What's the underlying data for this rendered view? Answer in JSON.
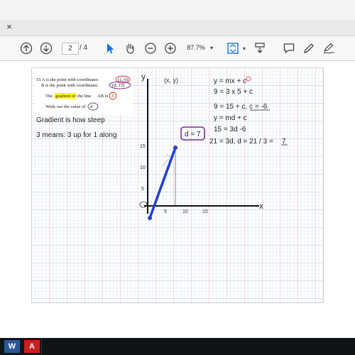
{
  "tab": {
    "close_glyph": "×"
  },
  "toolbar": {
    "page_current": "2",
    "page_total": "/ 4",
    "zoom": "87.7%",
    "zoom_dropdown": "▾",
    "icons": [
      "up-arrow-icon",
      "down-arrow-icon",
      "select-pointer-icon",
      "hand-icon",
      "zoom-out-icon",
      "zoom-in-icon",
      "fit-page-icon",
      "scroll-mode-icon",
      "comment-icon",
      "pen-icon",
      "sign-icon"
    ]
  },
  "document": {
    "question": {
      "line1": "15 A is the point with coordinates",
      "a_coords": "(1,-6)",
      "line2": "B is the point with coordinates",
      "b_coords": "(d, 15)",
      "line3_pre": "The",
      "line3_highlight": "gradient of",
      "line3_mid": "the line",
      "line3_ab": "AB is",
      "line3_val": "3",
      "line4": "Work out the value of",
      "line4_d": "d"
    },
    "notes": {
      "gradient": "Gradient is how steep",
      "meaning": "3 means: 3 up for 1 along"
    },
    "axes": {
      "y": "y",
      "x": "x",
      "xy": "(x, y)",
      "x5": "5",
      "x10": "10",
      "x15": "15",
      "y5": "5",
      "y10": "10",
      "y15": "15",
      "answer_box": "d = 7"
    },
    "working": {
      "l1": "y = mx + c",
      "l2": "9 = 3 x 5 + c",
      "l3": "9 = 15 + c, c = -6",
      "l4": "y = md + c",
      "l5": "15 = 3d -6",
      "l6": "21 = 3d, d = 21 / 3 =",
      "l6_answer": "7"
    }
  },
  "taskbar": {
    "word_label": "W",
    "acrobat_label": "A"
  },
  "colors": {
    "grid_blue": "#9bb8e0",
    "grid_red": "#f2a0a0",
    "line_blue": "#1f3fd6",
    "purple": "#7a2aa8",
    "red_ink": "#e02020",
    "highlight": "#ffff00"
  }
}
